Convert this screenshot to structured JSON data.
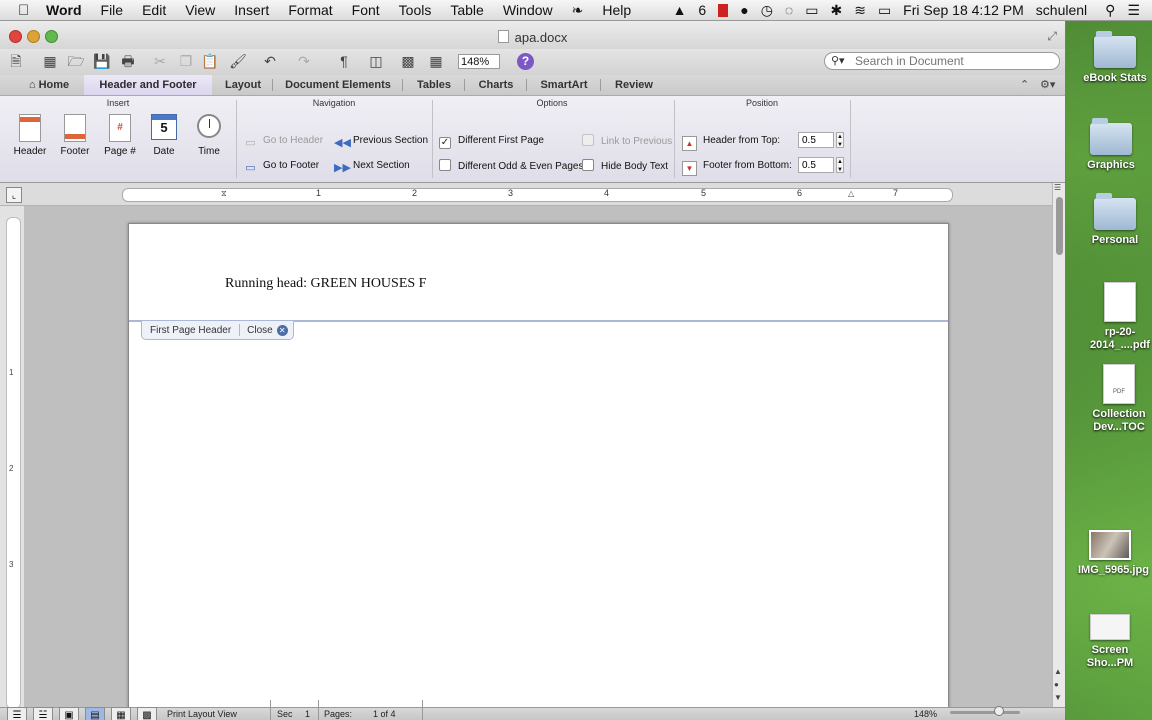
{
  "menubar": {
    "app": "Word",
    "items": [
      "File",
      "Edit",
      "View",
      "Insert",
      "Format",
      "Font",
      "Tools",
      "Table",
      "Window",
      "Help"
    ],
    "status": {
      "adobe_count": "6",
      "datetime": "Fri Sep 18  4:12 PM",
      "user": "schulenl"
    }
  },
  "window": {
    "title": "apa.docx",
    "zoom": "148%"
  },
  "search": {
    "placeholder": "Search in Document"
  },
  "ribbon_tabs": {
    "home": "Home",
    "header_footer": "Header and Footer",
    "layout": "Layout",
    "document_elements": "Document Elements",
    "tables": "Tables",
    "charts": "Charts",
    "smartart": "SmartArt",
    "review": "Review"
  },
  "ribbon": {
    "insert": {
      "title": "Insert",
      "header": "Header",
      "footer": "Footer",
      "page_num": "Page #",
      "date": "Date",
      "date_icon_num": "5",
      "time": "Time"
    },
    "navigation": {
      "title": "Navigation",
      "go_to_header": "Go to Header",
      "go_to_footer": "Go to Footer",
      "previous_section": "Previous Section",
      "next_section": "Next Section"
    },
    "options": {
      "title": "Options",
      "different_first_page": "Different First Page",
      "different_odd_even": "Different Odd & Even Pages",
      "link_to_previous": "Link to Previous",
      "hide_body_text": "Hide Body Text"
    },
    "position": {
      "title": "Position",
      "header_from_top_label": "Header from Top:",
      "header_from_top_value": "0.5",
      "footer_from_bottom_label": "Footer from Bottom:",
      "footer_from_bottom_value": "0.5"
    }
  },
  "ruler": {
    "numbers": [
      "1",
      "2",
      "3",
      "4",
      "5",
      "6",
      "7"
    ]
  },
  "vruler": {
    "numbers": [
      "1",
      "2",
      "3"
    ]
  },
  "document": {
    "running_head": "Running head: GREEN HOUSES F",
    "header_tag": "First Page Header",
    "close_label": "Close"
  },
  "statusbar": {
    "view_name": "Print Layout View",
    "sec_label": "Sec",
    "sec_value": "1",
    "pages_label": "Pages:",
    "pages_value": "1 of 4",
    "zoom": "148%"
  },
  "desktop_icons": [
    {
      "label": "eBook Stats",
      "kind": "folder"
    },
    {
      "label": "Graphics",
      "kind": "folder"
    },
    {
      "label": "Personal",
      "kind": "folder"
    },
    {
      "label": "rp-20-2014_....pdf",
      "kind": "doc"
    },
    {
      "label": "Collection Dev...TOC",
      "kind": "pdf"
    },
    {
      "label": "IMG_5965.jpg",
      "kind": "image"
    },
    {
      "label": "Screen Sho...PM",
      "kind": "screenshot"
    }
  ]
}
